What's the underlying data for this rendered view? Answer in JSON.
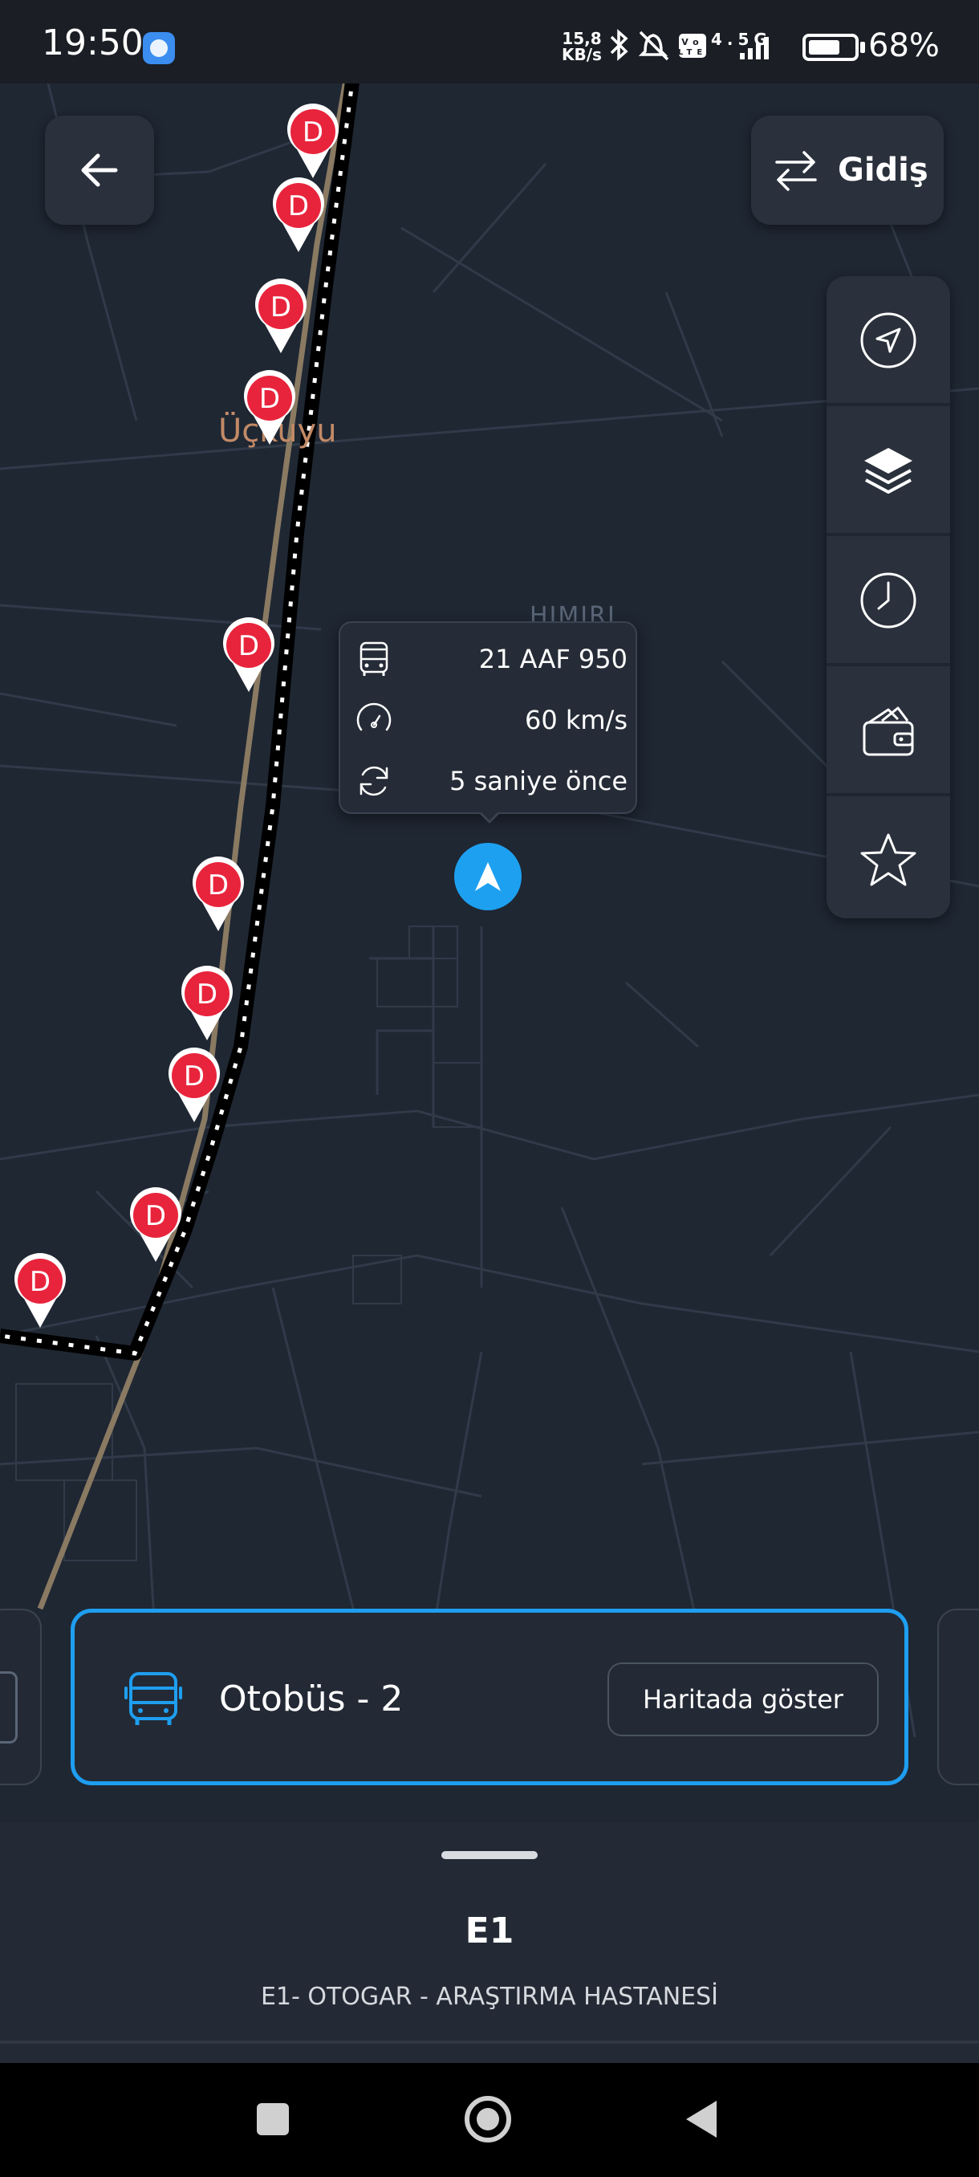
{
  "status_bar": {
    "time": "19:50",
    "net_rate_top": "15,8",
    "net_rate_bottom": "KB/s",
    "network_type": "4.5G",
    "battery": "68%"
  },
  "map": {
    "place_label": "Üçkuyu",
    "faint_label": "HIMIRI",
    "stop_letter": "D",
    "route_color": "#000000",
    "stop_color": "#e8243c",
    "road_color": "#8a7a62"
  },
  "header": {
    "direction_label": "Gidiş"
  },
  "popup": {
    "plate": "21 AAF 950",
    "speed": "60 km/s",
    "updated": "5 saniye önce"
  },
  "bus_card": {
    "title": "Otobüs - 2",
    "button_label": "Haritada göster",
    "accent": "#1e9ef0"
  },
  "sheet": {
    "route_code": "E1",
    "route_name": "E1- OTOGAR - ARAŞTIRMA HASTANESİ"
  },
  "side_panel": {
    "icons": [
      "navigation-icon",
      "layers-icon",
      "clock-icon",
      "wallet-icon",
      "star-icon"
    ]
  }
}
